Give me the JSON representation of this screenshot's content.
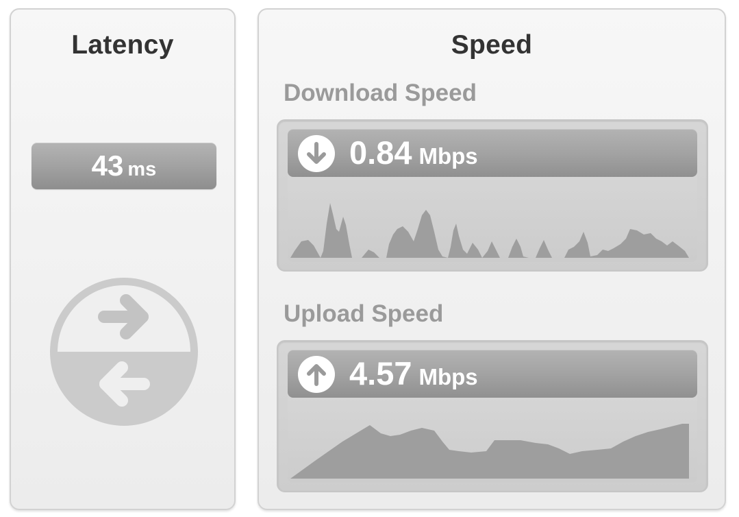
{
  "latency": {
    "title": "Latency",
    "value": "43",
    "unit": "ms",
    "icon": "latency-arrows-icon"
  },
  "speed": {
    "title": "Speed",
    "download": {
      "label": "Download Speed",
      "value": "0.84",
      "unit": "Mbps",
      "icon": "download-arrow-icon"
    },
    "upload": {
      "label": "Upload Speed",
      "value": "4.57",
      "unit": "Mbps",
      "icon": "upload-arrow-icon"
    }
  },
  "colors": {
    "panel_bg": "#efefef",
    "pill": "#a2a2a2",
    "graph_fill": "#9e9e9e",
    "label_gray": "#9a9a9a",
    "title": "#333333"
  }
}
